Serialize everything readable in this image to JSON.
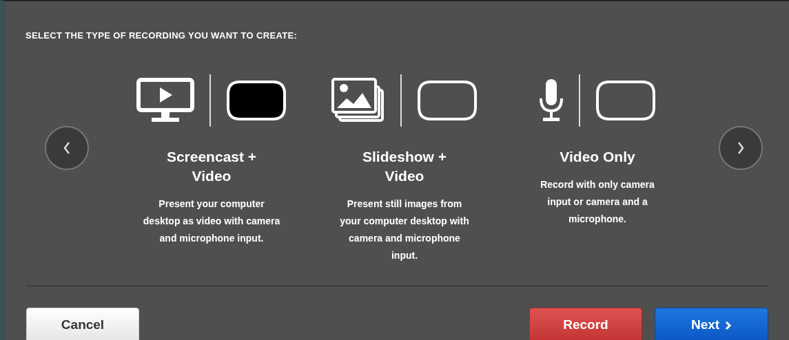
{
  "heading": "SELECT THE TYPE OF RECORDING YOU WANT TO CREATE:",
  "options": [
    {
      "kind": "screen",
      "title": "Screencast + Video",
      "description": "Present your computer desktop as video with camera and microphone input.",
      "selected": true
    },
    {
      "kind": "slides",
      "title": "Slideshow + Video",
      "description": "Present still images from your computer desktop with camera and microphone input.",
      "selected": false
    },
    {
      "kind": "mic",
      "title": "Video Only",
      "description": "Record with only camera input or camera and a microphone.",
      "selected": false
    }
  ],
  "buttons": {
    "cancel": "Cancel",
    "record": "Record",
    "next": "Next"
  }
}
